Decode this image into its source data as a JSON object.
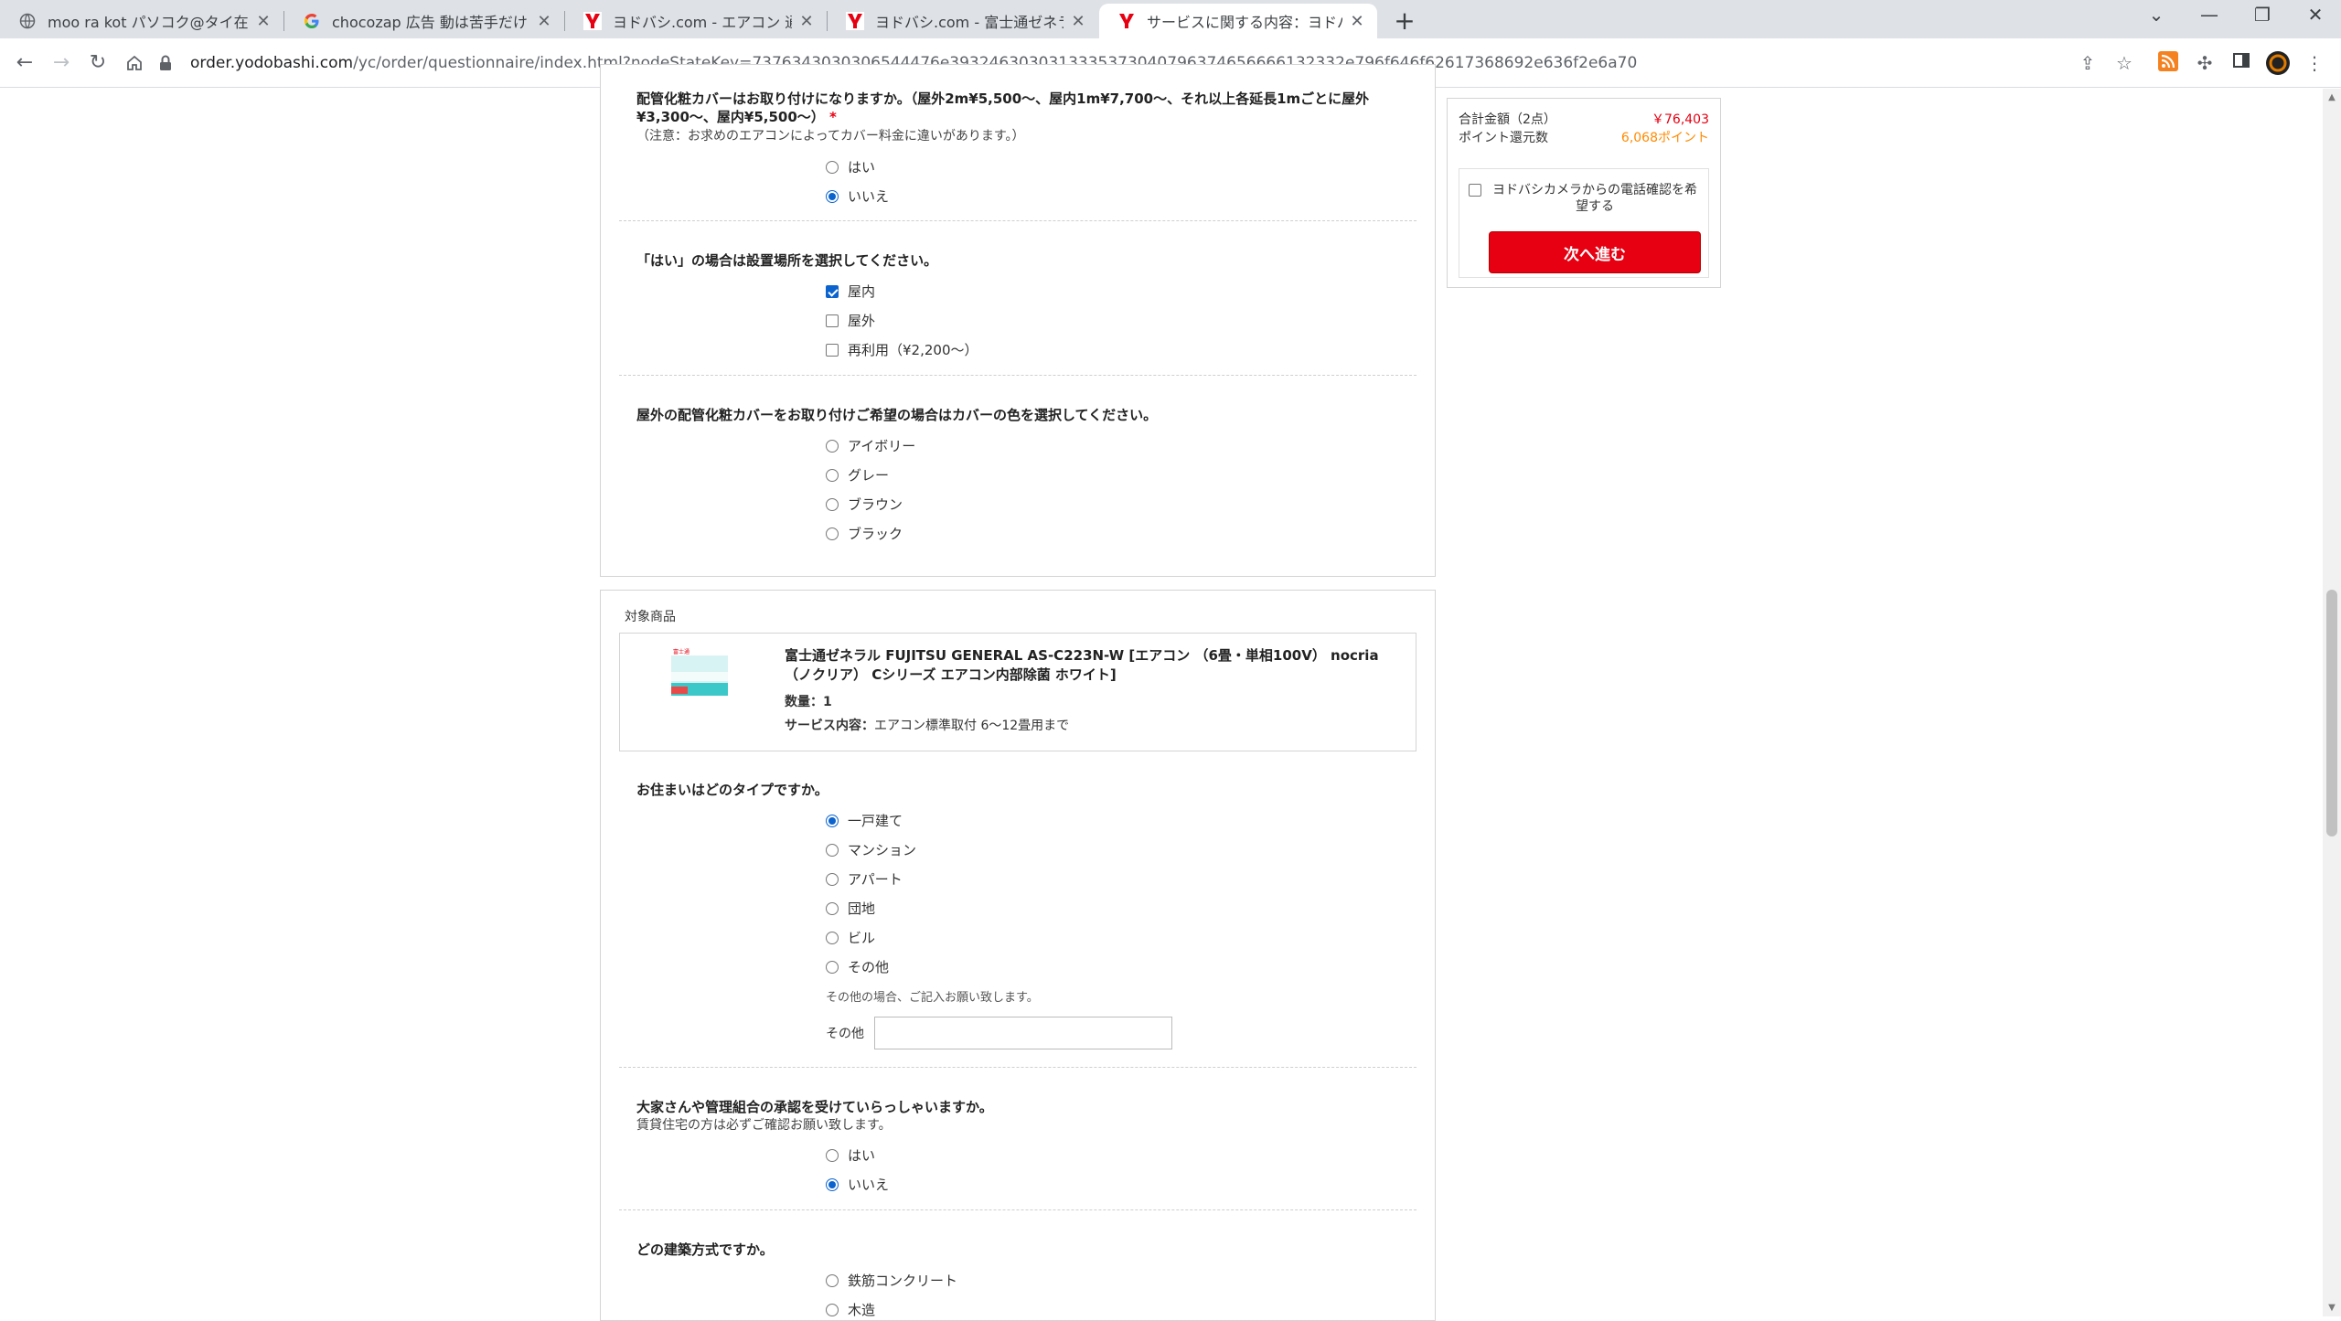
{
  "browser": {
    "tabs": [
      {
        "title": "moo ra kot パソコク@タイ在住／ii"
      },
      {
        "title": "chocozap 広告 動は苦手だけどス"
      },
      {
        "title": "ヨドバシ.com - エアコン 通販【全品"
      },
      {
        "title": "ヨドバシ.com - 富士通ゼネラル FUJI"
      },
      {
        "title": "サービスに関する内容：ヨドバシ・ドッ"
      }
    ],
    "url_host": "order.yodobashi.com",
    "url_path": "/yc/order/questionnaire/index.html?nodeStateKey=7376343030306544476e3932463030313335373040796374656666132332e796f646f62617368692e636f2e6a70"
  },
  "summary": {
    "total_label": "合計金額（2点）",
    "total_value": "￥76,403",
    "points_label": "ポイント還元数",
    "points_value": "6,068ポイント",
    "phone_confirm_label": "ヨドバシカメラからの電話確認を希望する",
    "next_button": "次へ進む"
  },
  "section1": {
    "q_cover": "配管化粧カバーはお取り付けになりますか。（屋外2m¥5,500～、屋内1m¥7,700～、それ以上各延長1mごとに屋外¥3,300～、屋内¥5,500～）",
    "required_mark": "*",
    "q_cover_note": "（注意：お求めのエアコンによってカバー料金に違いがあります。）",
    "cover_options": [
      {
        "label": "はい",
        "checked": false
      },
      {
        "label": "いいえ",
        "checked": true
      }
    ],
    "q_location": "「はい」の場合は設置場所を選択してください。",
    "location_options": [
      {
        "label": "屋内",
        "checked": true
      },
      {
        "label": "屋外",
        "checked": false
      },
      {
        "label": "再利用（¥2,200～）",
        "checked": false
      }
    ],
    "q_color": "屋外の配管化粧カバーをお取り付けご希望の場合はカバーの色を選択してください。",
    "color_options": [
      {
        "label": "アイボリー",
        "checked": false
      },
      {
        "label": "グレー",
        "checked": false
      },
      {
        "label": "ブラウン",
        "checked": false
      },
      {
        "label": "ブラック",
        "checked": false
      }
    ]
  },
  "section2": {
    "target_label": "対象商品",
    "product_name": "富士通ゼネラル FUJITSU GENERAL AS-C223N-W [エアコン （6畳・単相100V） nocria（ノクリア） Cシリーズ エアコン内部除菌 ホワイト]",
    "quantity_text": "数量：1",
    "service_label": "サービス内容：",
    "service_value": "エアコン標準取付 6～12畳用まで",
    "q_house": "お住まいはどのタイプですか。",
    "house_options": [
      {
        "label": "一戸建て",
        "checked": true
      },
      {
        "label": "マンション",
        "checked": false
      },
      {
        "label": "アパート",
        "checked": false
      },
      {
        "label": "団地",
        "checked": false
      },
      {
        "label": "ビル",
        "checked": false
      },
      {
        "label": "その他",
        "checked": false
      }
    ],
    "other_note": "その他の場合、ご記入お願い致します。",
    "other_label": "その他",
    "other_value": "",
    "q_landlord": "大家さんや管理組合の承認を受けていらっしゃいますか。",
    "landlord_note": "賃貸住宅の方は必ずご確認お願い致します。",
    "landlord_options": [
      {
        "label": "はい",
        "checked": false
      },
      {
        "label": "いいえ",
        "checked": true
      }
    ],
    "q_structure": "どの建築方式ですか。",
    "structure_options": [
      {
        "label": "鉄筋コンクリート",
        "checked": false
      },
      {
        "label": "木造",
        "checked": false
      }
    ]
  }
}
